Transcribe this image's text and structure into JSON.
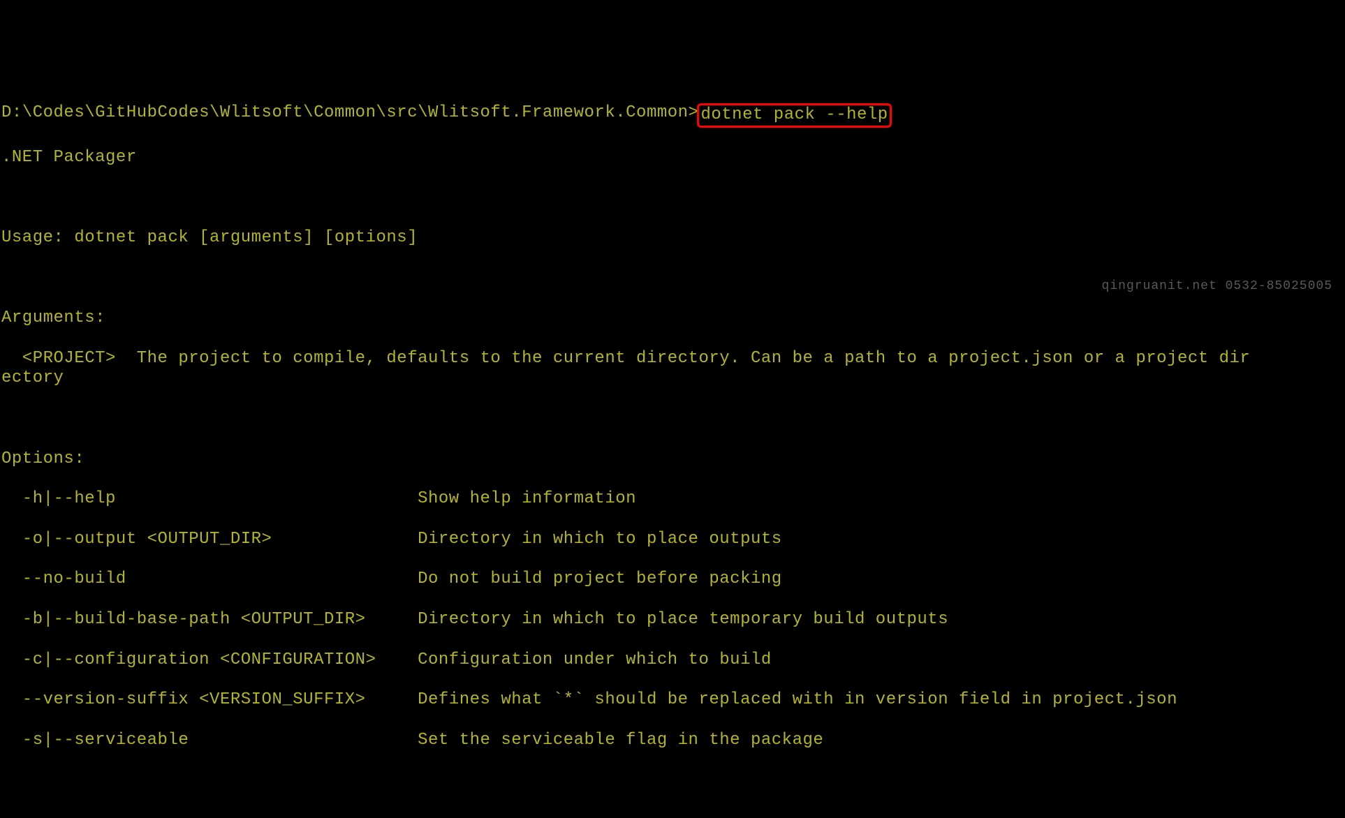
{
  "prompt": {
    "path": "D:\\Codes\\GitHubCodes\\Wlitsoft\\Common\\src\\Wlitsoft.Framework.Common>",
    "command": "dotnet pack --help"
  },
  "title": ".NET Packager",
  "usage": "Usage: dotnet pack [arguments] [options]",
  "arguments_header": "Arguments:",
  "arguments_body": "  <PROJECT>  The project to compile, defaults to the current directory. Can be a path to a project.json or a project dir\nectory",
  "options_header": "Options:",
  "options": [
    {
      "flag": "  -h|--help                             ",
      "desc": "Show help information"
    },
    {
      "flag": "  -o|--output <OUTPUT_DIR>              ",
      "desc": "Directory in which to place outputs"
    },
    {
      "flag": "  --no-build                            ",
      "desc": "Do not build project before packing"
    },
    {
      "flag": "  -b|--build-base-path <OUTPUT_DIR>     ",
      "desc": "Directory in which to place temporary build outputs"
    },
    {
      "flag": "  -c|--configuration <CONFIGURATION>    ",
      "desc": "Configuration under which to build"
    },
    {
      "flag": "  --version-suffix <VERSION_SUFFIX>     ",
      "desc": "Defines what `*` should be replaced with in version field in project.json"
    },
    {
      "flag": "  -s|--serviceable                      ",
      "desc": "Set the serviceable flag in the package"
    }
  ],
  "watermark": "qingruanit.net 0532-85025005"
}
